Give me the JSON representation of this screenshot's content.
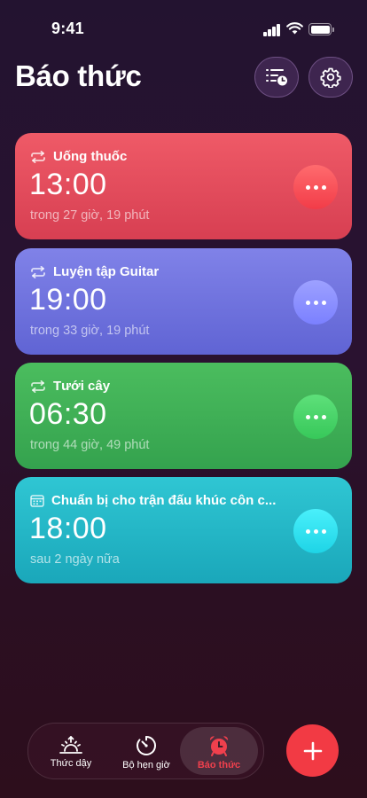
{
  "status_bar": {
    "time": "9:41"
  },
  "header": {
    "title": "Báo thức"
  },
  "alarms": [
    {
      "label": "Uống thuốc",
      "time": "13:00",
      "remaining": "trong 27 giờ, 19 phút",
      "repeat_icon": "repeat-icon",
      "color": "#e24b5c"
    },
    {
      "label": "Luyện tập Guitar",
      "time": "19:00",
      "remaining": "trong 33 giờ, 19 phút",
      "repeat_icon": "repeat-icon",
      "color": "#7174df"
    },
    {
      "label": "Tưới cây",
      "time": "06:30",
      "remaining": "trong 44 giờ, 49 phút",
      "repeat_icon": "repeat-icon",
      "color": "#40b057"
    },
    {
      "label": "Chuẩn bị cho trận đấu khúc côn c...",
      "time": "18:00",
      "remaining": "sau 2 ngày nữa",
      "repeat_icon": "calendar-icon",
      "color": "#25b7c7"
    }
  ],
  "tabs": [
    {
      "label": "Thức dậy",
      "icon": "sunrise-icon",
      "active": false
    },
    {
      "label": "Bộ hẹn giờ",
      "icon": "timer-icon",
      "active": false
    },
    {
      "label": "Báo thức",
      "icon": "alarm-clock-icon",
      "active": true
    }
  ],
  "colors": {
    "accent": "#f23a44"
  }
}
